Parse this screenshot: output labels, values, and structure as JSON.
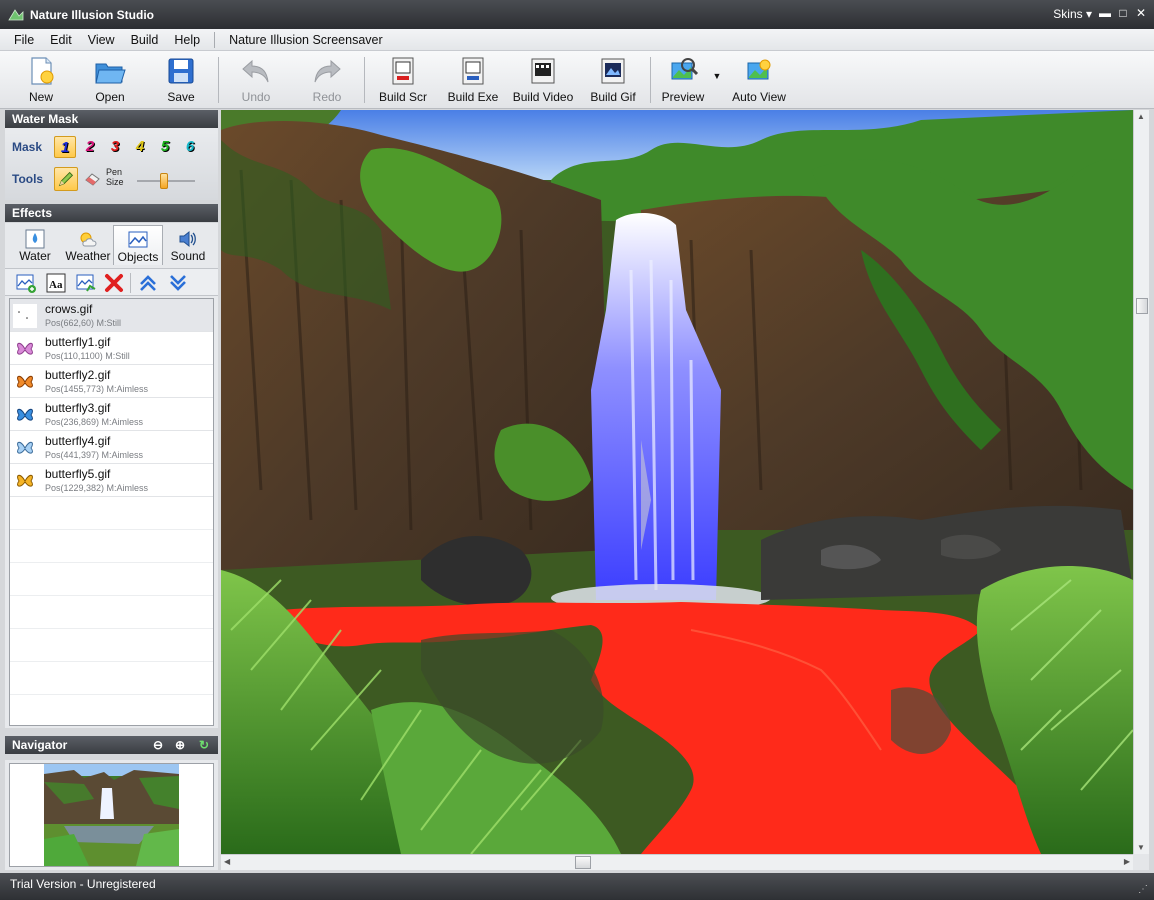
{
  "window": {
    "title": "Nature Illusion Studio",
    "skins_label": "Skins",
    "minimize": "▬",
    "maximize": "□",
    "close": "✕"
  },
  "menu": {
    "items": [
      "File",
      "Edit",
      "View",
      "Build",
      "Help"
    ],
    "extra": "Nature Illusion Screensaver"
  },
  "toolbar": {
    "new": "New",
    "open": "Open",
    "save": "Save",
    "undo": "Undo",
    "redo": "Redo",
    "build_scr": "Build Scr",
    "build_exe": "Build Exe",
    "build_video": "Build Video",
    "build_gif": "Build Gif",
    "preview": "Preview",
    "auto_view": "Auto View"
  },
  "water_mask": {
    "header": "Water Mask",
    "mask_label": "Mask",
    "tools_label": "Tools",
    "pen_size_label": "Pen Size",
    "pen_size_level": 0.45,
    "masks": [
      {
        "label": "1",
        "color": "#1b2bd8"
      },
      {
        "label": "2",
        "color": "#d8157a"
      },
      {
        "label": "3",
        "color": "#e01c1c"
      },
      {
        "label": "4",
        "color": "#e0c81a"
      },
      {
        "label": "5",
        "color": "#1db21d"
      },
      {
        "label": "6",
        "color": "#16b8c9"
      }
    ],
    "selected_mask": "1"
  },
  "effects": {
    "header": "Effects",
    "tabs": [
      "Water",
      "Weather",
      "Objects",
      "Sound"
    ],
    "selected_tab": "Objects"
  },
  "objects": [
    {
      "name": "crows.gif",
      "info": "Pos(662,60) M:Still",
      "icon": "crows-thumbnail-icon"
    },
    {
      "name": "butterfly1.gif",
      "info": "Pos(110,1100) M:Still",
      "icon": "butterfly-pink-icon"
    },
    {
      "name": "butterfly2.gif",
      "info": "Pos(1455,773) M:Aimless",
      "icon": "butterfly-orange-icon"
    },
    {
      "name": "butterfly3.gif",
      "info": "Pos(236,869) M:Aimless",
      "icon": "butterfly-blue-icon"
    },
    {
      "name": "butterfly4.gif",
      "info": "Pos(441,397) M:Aimless",
      "icon": "butterfly-lightblue-icon"
    },
    {
      "name": "butterfly5.gif",
      "info": "Pos(1229,382) M:Aimless",
      "icon": "butterfly-yellow-icon"
    }
  ],
  "navigator": {
    "header": "Navigator"
  },
  "status": {
    "text": "Trial Version - Unregistered"
  },
  "colors": {
    "water_mask_overlay": "#ff2a1a",
    "waterfall_overlay": "#4a4cff",
    "accent_header": "#3a3d42",
    "label_blue": "#2a4a84"
  }
}
